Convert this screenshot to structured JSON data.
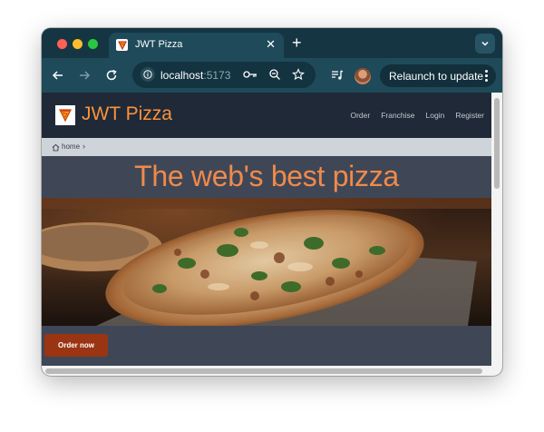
{
  "browser": {
    "tab": {
      "title": "JWT Pizza",
      "close_glyph": "✕"
    },
    "new_tab_glyph": "+",
    "address": {
      "host": "localhost",
      "port": ":5173"
    },
    "relaunch_label": "Relaunch to update",
    "icons": [
      "back-icon",
      "forward-icon",
      "reload-icon",
      "info-icon",
      "key-icon",
      "zoom-icon",
      "star-icon",
      "media-icon",
      "profile-avatar",
      "tab-search-icon"
    ]
  },
  "site": {
    "brand": "JWT Pizza",
    "nav": [
      "Order",
      "Franchise",
      "Login",
      "Register"
    ],
    "breadcrumb": {
      "home": "home",
      "separator": "›"
    },
    "hero_title": "The web's best pizza",
    "order_button": "Order now"
  },
  "colors": {
    "accent": "#fb923c",
    "button": "#9a3412",
    "header_bg": "#1f2937",
    "page_bg": "#3f4756",
    "chrome_tab": "#163543"
  }
}
